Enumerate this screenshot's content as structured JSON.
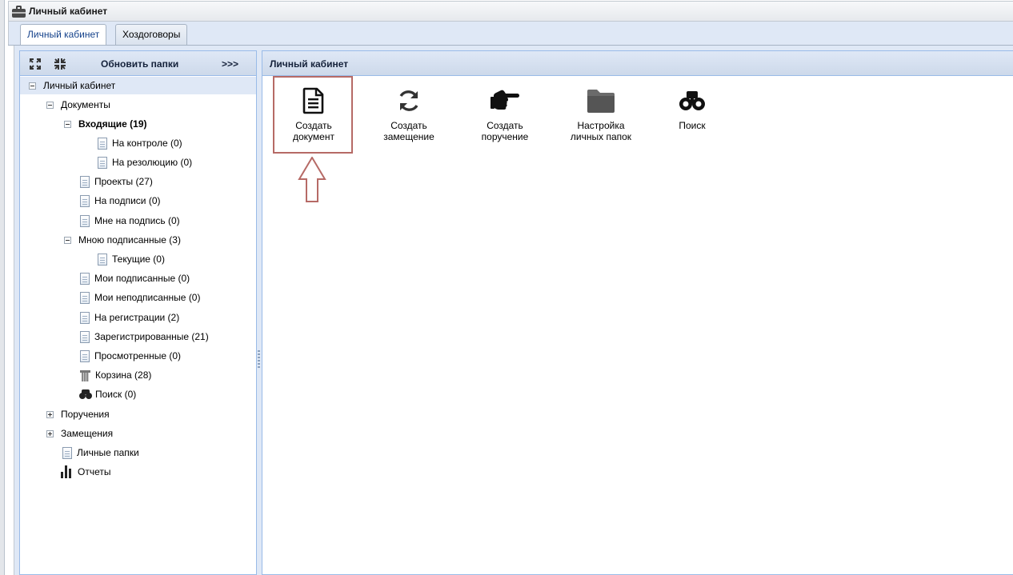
{
  "window": {
    "title": "Личный кабинет"
  },
  "tabs": [
    {
      "label": "Личный кабинет",
      "active": true
    },
    {
      "label": "Хоздоговоры",
      "active": false
    }
  ],
  "left_panel": {
    "refresh_label": "Обновить папки",
    "more_label": ">>>",
    "icons": {
      "expand": "expand-all-icon",
      "collapse": "collapse-all-icon"
    }
  },
  "tree": {
    "root": "Личный кабинет",
    "documents": "Документы",
    "incoming": "Входящие (19)",
    "on_control": "На контроле (0)",
    "on_resolution": "На резолюцию (0)",
    "drafts": "Проекты (27)",
    "on_signing": "На подписи (0)",
    "to_me_for_signing": "Мне на подпись (0)",
    "signed_by_me": "Мною подписанные (3)",
    "current": "Текущие (0)",
    "my_signed": "Мои подписанные (0)",
    "my_unsigned": "Мои неподписанные (0)",
    "on_registration": "На регистрации (2)",
    "registered": "Зарегистрированные (21)",
    "viewed": "Просмотренные (0)",
    "trash": "Корзина (28)",
    "search": "Поиск (0)",
    "assignments": "Поручения",
    "substitutions": "Замещения",
    "personal_folders": "Личные папки",
    "reports": "Отчеты"
  },
  "right_panel": {
    "title": "Личный кабинет",
    "actions": [
      {
        "label": "Создать\nдокумент",
        "icon": "document-icon"
      },
      {
        "label": "Создать\nзамещение",
        "icon": "sync-icon"
      },
      {
        "label": "Создать\nпоручение",
        "icon": "pointing-hand-icon"
      },
      {
        "label": "Настройка\nличных папок",
        "icon": "folder-icon"
      },
      {
        "label": "Поиск",
        "icon": "binoculars-icon"
      }
    ]
  },
  "colors": {
    "accent": "#15428b",
    "highlight_annotation": "#b66a66",
    "panel_header": "#dfe8f6"
  }
}
